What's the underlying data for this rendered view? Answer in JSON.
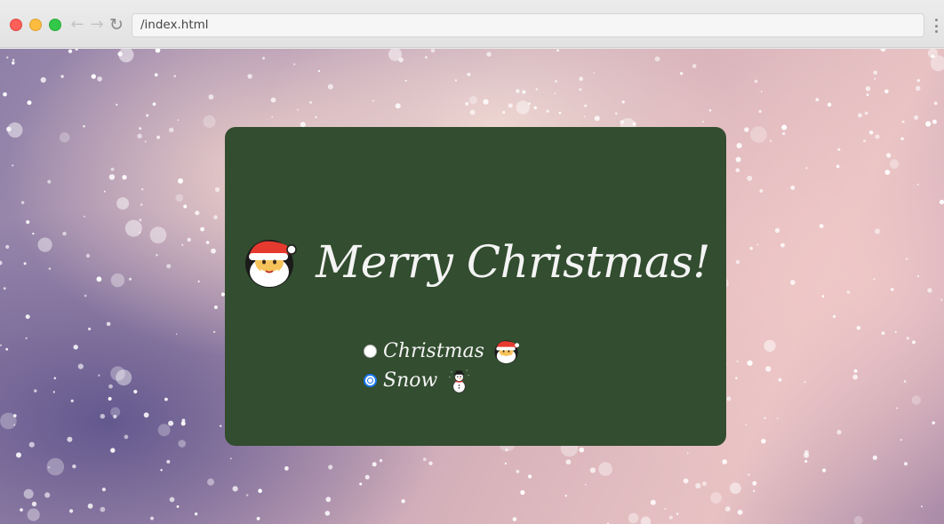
{
  "browser": {
    "url": "/index.html",
    "back_glyph": "←",
    "forward_glyph": "→",
    "reload_glyph": "↻"
  },
  "card": {
    "title": "Merry Christmas!",
    "title_icon": "santa-icon",
    "background": "#324d2f"
  },
  "options": [
    {
      "label": "Christmas",
      "icon": "santa-icon",
      "selected": false
    },
    {
      "label": "Snow",
      "icon": "snowman-icon",
      "selected": true
    }
  ]
}
